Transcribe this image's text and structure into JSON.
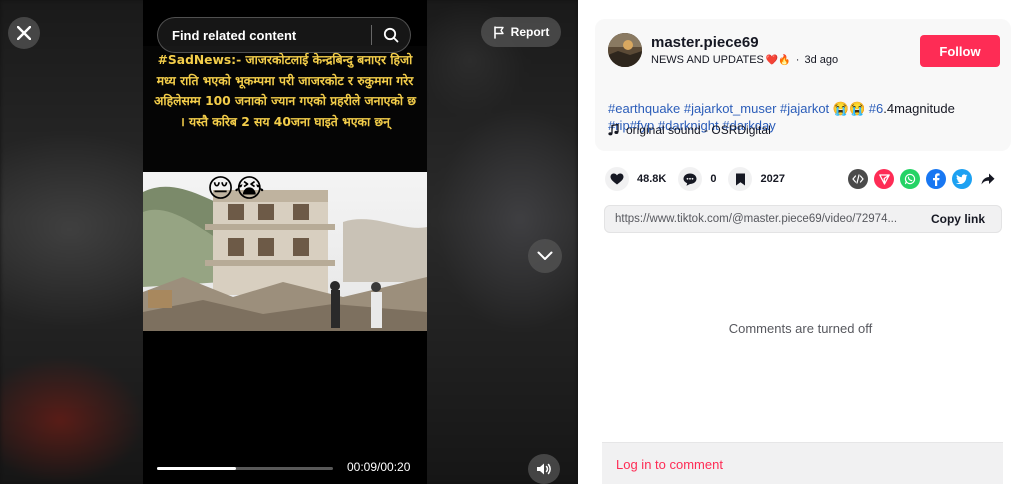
{
  "video": {
    "search_placeholder": "Find related content",
    "report_label": "Report",
    "caption": "#SadNews:- जाजरकोटलाई केन्द्रबिन्दु बनाएर हिजो मध्य राति भएको भूकम्पमा परी जाजरकोट र रुकुममा गरेर अहिलेसम्म 100 जनाको ज्यान गएको प्रहरीले जनाएको छ । यस्तै करिब 2 सय 40जना घाइते भएका छन्",
    "overlay_emoji": "😔😭",
    "time": "00:09/00:20",
    "progress_fraction": 0.45
  },
  "author": {
    "username": "master.piece69",
    "nickname": "NEWS AND UPDATES",
    "nickname_emoji": "❤️🔥",
    "age": "3d ago",
    "follow_label": "Follow"
  },
  "description": {
    "line1": [
      {
        "text": "#earthquake",
        "tag": true
      },
      {
        "text": " ",
        "tag": false
      },
      {
        "text": "#jajarkot_muser",
        "tag": true
      },
      {
        "text": " ",
        "tag": false
      },
      {
        "text": "#jajarkot",
        "tag": true
      },
      {
        "text": " 😭😭 ",
        "tag": false
      },
      {
        "text": "#6",
        "tag": true
      },
      {
        "text": ".4magnitude",
        "tag": false
      }
    ],
    "line2": [
      {
        "text": "#rip",
        "tag": true
      },
      {
        "text": "#fyp",
        "tag": true
      },
      {
        "text": " ",
        "tag": false
      },
      {
        "text": "#darknight",
        "tag": true
      },
      {
        "text": " ",
        "tag": false
      },
      {
        "text": "#darkday",
        "tag": true
      }
    ]
  },
  "sound": {
    "label": "original sound - OSRDigital"
  },
  "stats": {
    "likes": "48.8K",
    "comments": "0",
    "saves": "2027"
  },
  "share": {
    "icons": [
      "embed-icon",
      "send-icon",
      "whatsapp-icon",
      "facebook-icon",
      "twitter-icon",
      "share-arrow-icon"
    ],
    "colors": {
      "embed": "#4a4a4a",
      "send": "#fe2c55",
      "whatsapp": "#25d366",
      "facebook": "#1877f2",
      "twitter": "#1da1f2"
    }
  },
  "link": {
    "url": "https://www.tiktok.com/@master.piece69/video/72974...",
    "copy_label": "Copy link"
  },
  "comments": {
    "status": "Comments are turned off",
    "login_label": "Log in to comment"
  },
  "colors": {
    "accent": "#fe2c55",
    "hashtag": "#2b5db9",
    "caption": "#f3cd4a"
  }
}
